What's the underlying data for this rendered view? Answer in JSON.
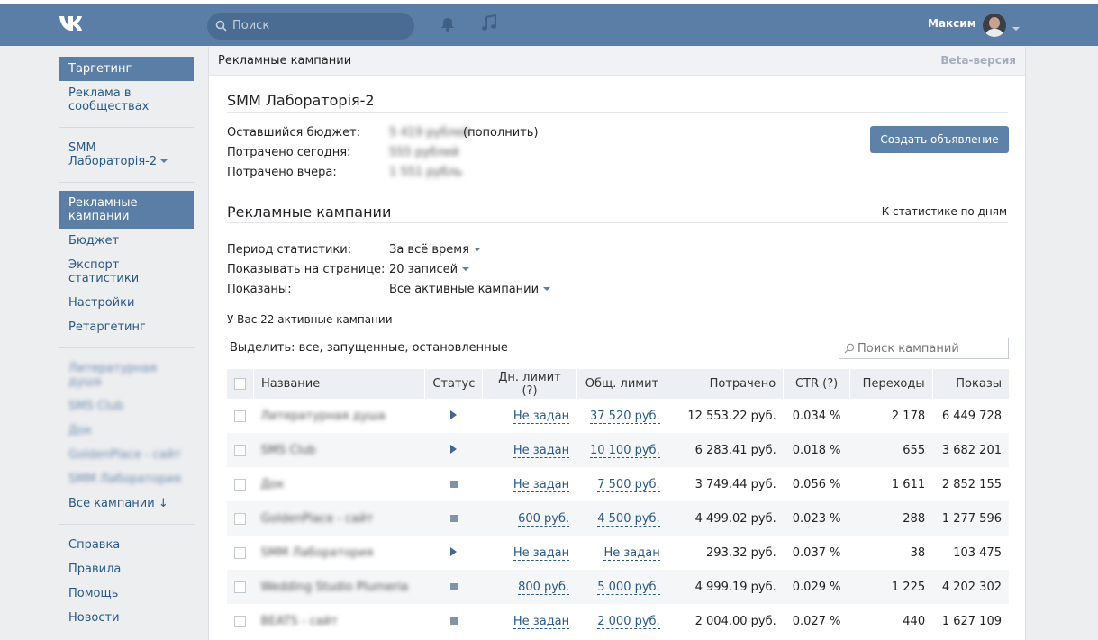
{
  "header": {
    "search_placeholder": "Поиск",
    "user_name": "Максим",
    "icons": [
      "vk-logo-icon",
      "search-icon",
      "bell-icon",
      "music-icon",
      "chevron-down-icon"
    ],
    "colors": {
      "topbar": "#5b7ea6",
      "accent": "#5e81a8"
    }
  },
  "sidebar": {
    "targeting": "Таргетинг",
    "community_ads": "Реклама в сообществах",
    "cabinet": "SMM Лабораторія-2",
    "campaigns": "Рекламные кампании",
    "budget": "Бюджет",
    "export": "Экспорт статистики",
    "settings": "Настройки",
    "retargeting": "Ретаргетинг",
    "all_campaigns": "Все кампании ↓",
    "help_ref": "Справка",
    "rules": "Правила",
    "help": "Помощь",
    "news": "Новости"
  },
  "main": {
    "header_title": "Рекламные кампании",
    "beta_label": "Beta-версия",
    "cabinet_title": "SMM Лабораторія-2",
    "remaining_budget_label": "Оставшийся бюджет:",
    "replenish_link": "(пополнить)",
    "spent_today_label": "Потрачено сегодня:",
    "spent_yesterday_label": "Потрачено вчера:",
    "create_ad_button": "Создать объявление",
    "section_title": "Рекламные кампании",
    "stats_by_day_link": "К статистике по дням",
    "filters": {
      "period_label": "Период статистики:",
      "period_value": "За всё время",
      "per_page_label": "Показывать на странице:",
      "per_page_value": "20 записей",
      "shown_label": "Показаны:",
      "shown_value": "Все активные кампании"
    },
    "count_text": "У Вас 22 активные кампании",
    "select_text": "Выделить: все, запущенные, остановленные",
    "search_placeholder": "Поиск кампаний"
  },
  "table": {
    "headers": {
      "name": "Название",
      "status": "Статус",
      "daily_limit": "Дн. лимит (?)",
      "total_limit": "Общ. лимит",
      "spent": "Потрачено",
      "ctr": "CTR (?)",
      "clicks": "Переходы",
      "impressions": "Показы"
    },
    "rows": [
      {
        "status": "running",
        "daily_limit": "Не задан",
        "total_limit": "37 520 руб.",
        "spent": "12 553.22 руб.",
        "ctr": "0.034 %",
        "clicks": "2 178",
        "impressions": "6 449 728"
      },
      {
        "status": "running",
        "daily_limit": "Не задан",
        "total_limit": "10 100 руб.",
        "spent": "6 283.41 руб.",
        "ctr": "0.018 %",
        "clicks": "655",
        "impressions": "3 682 201"
      },
      {
        "status": "stopped",
        "daily_limit": "Не задан",
        "total_limit": "7 500 руб.",
        "spent": "3 749.44 руб.",
        "ctr": "0.056 %",
        "clicks": "1 611",
        "impressions": "2 852 155"
      },
      {
        "status": "stopped",
        "daily_limit": "600 руб.",
        "total_limit": "4 500 руб.",
        "spent": "4 499.02 руб.",
        "ctr": "0.023 %",
        "clicks": "288",
        "impressions": "1 277 596"
      },
      {
        "status": "running",
        "daily_limit": "Не задан",
        "total_limit": "Не задан",
        "spent": "293.32 руб.",
        "ctr": "0.037 %",
        "clicks": "38",
        "impressions": "103 475"
      },
      {
        "status": "stopped",
        "daily_limit": "800 руб.",
        "total_limit": "5 000 руб.",
        "spent": "4 999.19 руб.",
        "ctr": "0.029 %",
        "clicks": "1 225",
        "impressions": "4 202 302"
      },
      {
        "status": "stopped",
        "daily_limit": "Не задан",
        "total_limit": "2 000 руб.",
        "spent": "2 004.00 руб.",
        "ctr": "0.027 %",
        "clicks": "440",
        "impressions": "1 627 109"
      }
    ]
  }
}
